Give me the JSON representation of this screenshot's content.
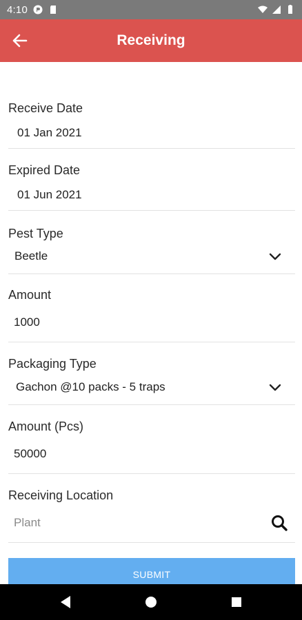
{
  "status_bar": {
    "time": "4:10",
    "icons": [
      "app-notification-icon",
      "sd-card-icon",
      "wifi-icon",
      "signal-icon",
      "battery-icon"
    ]
  },
  "app_bar": {
    "title": "Receiving",
    "back_icon": "arrow-left-icon",
    "color": "#db534f"
  },
  "form": {
    "receive_date": {
      "label": "Receive Date",
      "value": "01 Jan 2021"
    },
    "expired_date": {
      "label": "Expired Date",
      "value": "01 Jun 2021"
    },
    "pest_type": {
      "label": "Pest Type",
      "value": "Beetle",
      "icon": "chevron-down-icon"
    },
    "amount": {
      "label": "Amount",
      "value": "1000"
    },
    "packaging_type": {
      "label": "Packaging Type",
      "value": "Gachon @10 packs - 5 traps",
      "icon": "chevron-down-icon"
    },
    "amount_pcs": {
      "label": "Amount (Pcs)",
      "value": "50000"
    },
    "receiving_location": {
      "label": "Receiving Location",
      "placeholder": "Plant",
      "icon": "search-icon"
    }
  },
  "submit": {
    "label": "SUBMIT",
    "color": "#63aef0"
  },
  "nav_bar": {
    "buttons": [
      "back-triangle-icon",
      "home-circle-icon",
      "recents-square-icon"
    ]
  }
}
